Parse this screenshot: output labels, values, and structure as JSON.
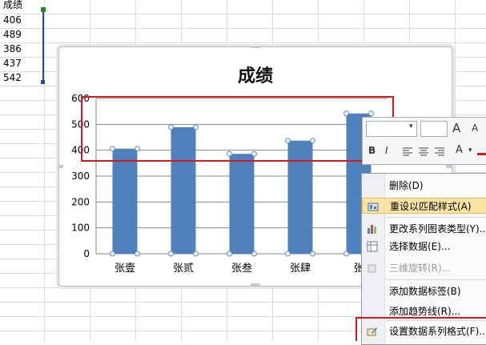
{
  "sheet": {
    "header": "成绩",
    "values": [
      "406",
      "489",
      "386",
      "437",
      "542"
    ]
  },
  "chart_data": {
    "type": "bar",
    "title": "成绩",
    "categories": [
      "张壹",
      "张贰",
      "张叁",
      "张肆",
      "张"
    ],
    "values": [
      406,
      489,
      386,
      437,
      542
    ],
    "ylim": [
      0,
      600
    ],
    "yticks": [
      "0",
      "100",
      "200",
      "300",
      "400",
      "500",
      "600"
    ],
    "grid": true,
    "bar_color": "#4f81bd"
  },
  "minibar": {
    "bold": "B",
    "italic": "I",
    "grow_font": "A",
    "shrink_font": "A",
    "font_color": "A"
  },
  "context_menu": {
    "items": [
      {
        "label": "删除(D)",
        "icon": "",
        "enabled": true
      },
      {
        "label": "重设以匹配样式(A)",
        "icon": "reset-style-icon",
        "enabled": true,
        "highlighted": true
      },
      {
        "label": "更改系列图表类型(Y)...",
        "icon": "chart-type-icon",
        "enabled": true
      },
      {
        "label": "选择数据(E)...",
        "icon": "select-data-icon",
        "enabled": true
      },
      {
        "label": "三维旋转(R)...",
        "icon": "rotate-3d-icon",
        "enabled": false
      },
      {
        "label": "添加数据标签(B)",
        "icon": "",
        "enabled": true
      },
      {
        "label": "添加趋势线(R)...",
        "icon": "",
        "enabled": true
      },
      {
        "label": "设置数据系列格式(F)...",
        "icon": "format-series-icon",
        "enabled": true
      }
    ]
  },
  "colors": {
    "annotation_red": "#d7191c",
    "selection_blue": "#1f4ea0",
    "menu_highlight": "#fbe3a4"
  }
}
